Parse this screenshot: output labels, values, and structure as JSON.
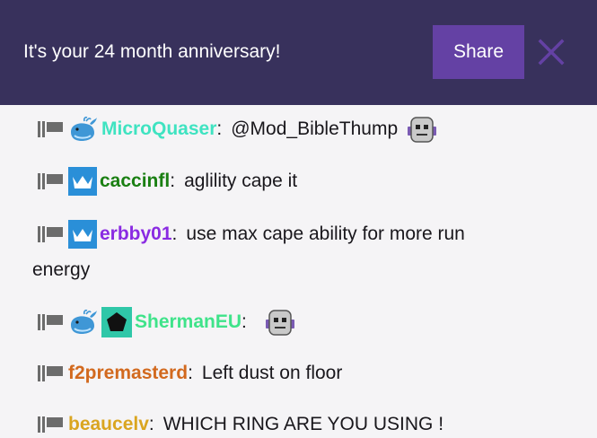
{
  "banner": {
    "text": "It's your 24 month anniversary!",
    "share_label": "Share",
    "close_icon": "close-icon"
  },
  "colors": {
    "banner_bg": "#38315c",
    "share_bg": "#6441a4",
    "chat_bg": "#f5f4f6"
  },
  "messages": [
    {
      "user": "MicroQuaser",
      "user_color": "#3fe3c1",
      "badges": [
        "whale-icon"
      ],
      "text": "@Mod_BibleThump",
      "emote": "robot-emote"
    },
    {
      "user": "caccinfl",
      "user_color": "#1a7f12",
      "badges": [
        "crown-badge-icon"
      ],
      "text": "aglility cape it"
    },
    {
      "user": "erbby01",
      "user_color": "#8a2be2",
      "badges": [
        "crown-badge-icon"
      ],
      "text": "use max cape ability for more run",
      "text_cont": "energy"
    },
    {
      "user": "ShermanEU",
      "user_color": "#3fe38a",
      "badges": [
        "whale-icon",
        "pentagon-badge-icon"
      ],
      "text": "",
      "emote": "robot-emote"
    },
    {
      "user": "f2premasterd",
      "user_color": "#d2691e",
      "badges": [],
      "text": "Left dust on floor"
    },
    {
      "user": "beaucelv",
      "user_color": "#daa520",
      "badges": [],
      "text": "WHICH RING ARE YOU USING !"
    }
  ]
}
